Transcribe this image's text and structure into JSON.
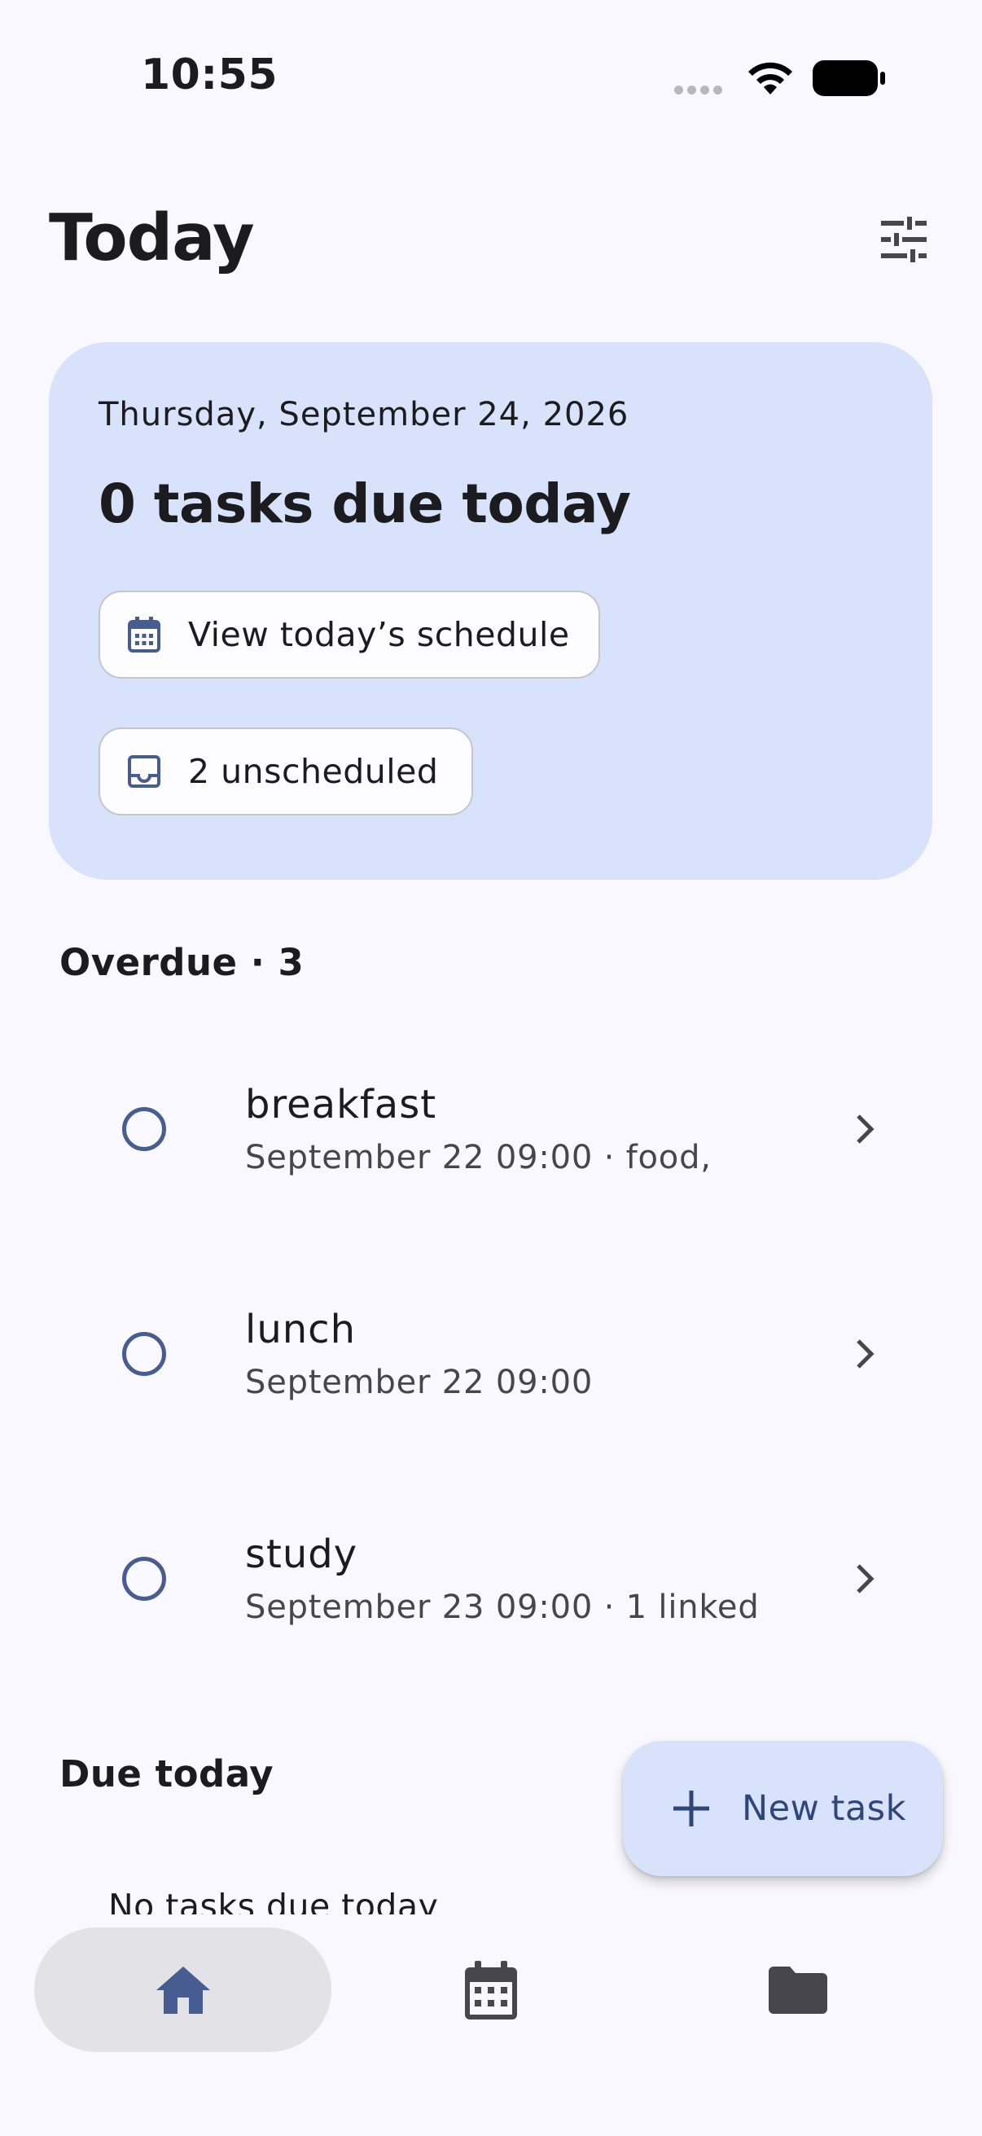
{
  "status_bar": {
    "time": "10:55"
  },
  "header": {
    "title": "Today",
    "filter_icon": "tune-icon"
  },
  "summary": {
    "date": "Thursday, September 24, 2026",
    "count_text": "0 tasks due today",
    "schedule_chip": {
      "label": "View today’s schedule",
      "icon": "calendar-icon"
    },
    "unscheduled_chip": {
      "label": "2 unscheduled",
      "icon": "inbox-icon"
    }
  },
  "overdue": {
    "title": "Overdue · 3",
    "tasks": [
      {
        "name": "breakfast",
        "meta": "September 22 09:00 · food,"
      },
      {
        "name": "lunch",
        "meta": "September 22 09:00"
      },
      {
        "name": "study",
        "meta": "September 23 09:00 · 1 linked"
      }
    ]
  },
  "due_today": {
    "title": "Due today",
    "empty_text": "No tasks due today"
  },
  "fab": {
    "label": "New task",
    "icon": "plus-icon"
  },
  "nav": {
    "items": [
      "home-icon",
      "calendar-icon",
      "folder-icon"
    ],
    "active": "home"
  },
  "colors": {
    "accent": "#475d92",
    "card": "#d8e2fb",
    "background": "#f9f8fe"
  }
}
